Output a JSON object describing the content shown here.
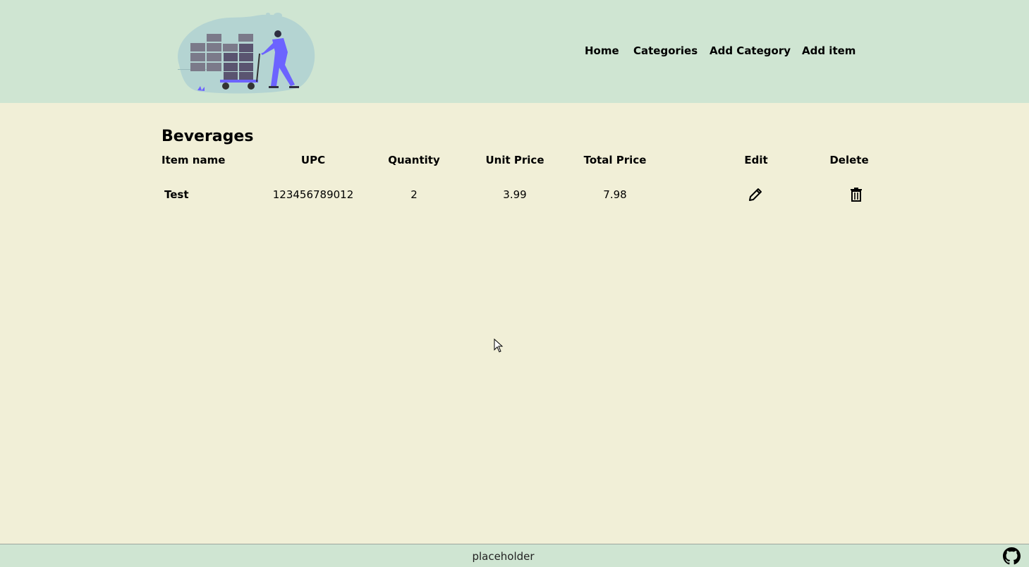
{
  "nav": {
    "items": [
      {
        "label": "Home"
      },
      {
        "label": "Categories"
      },
      {
        "label": "Add Category"
      },
      {
        "label": "Add item"
      }
    ]
  },
  "page": {
    "title": "Beverages"
  },
  "table": {
    "headers": [
      "Item name",
      "UPC",
      "Quantity",
      "Unit Price",
      "Total Price",
      "Edit",
      "Delete"
    ],
    "rows": [
      {
        "item_name": "Test",
        "upc": "123456789012",
        "quantity": "2",
        "unit_price": "3.99",
        "total_price": "7.98",
        "edit_icon": "pencil-icon",
        "delete_icon": "trash-icon"
      }
    ]
  },
  "footer": {
    "text": "placeholder",
    "icon": "github-icon"
  },
  "colors": {
    "header_bg": "#cfe5d2",
    "page_bg": "#f1efd7",
    "illustration_accent": "#6c63ff"
  }
}
